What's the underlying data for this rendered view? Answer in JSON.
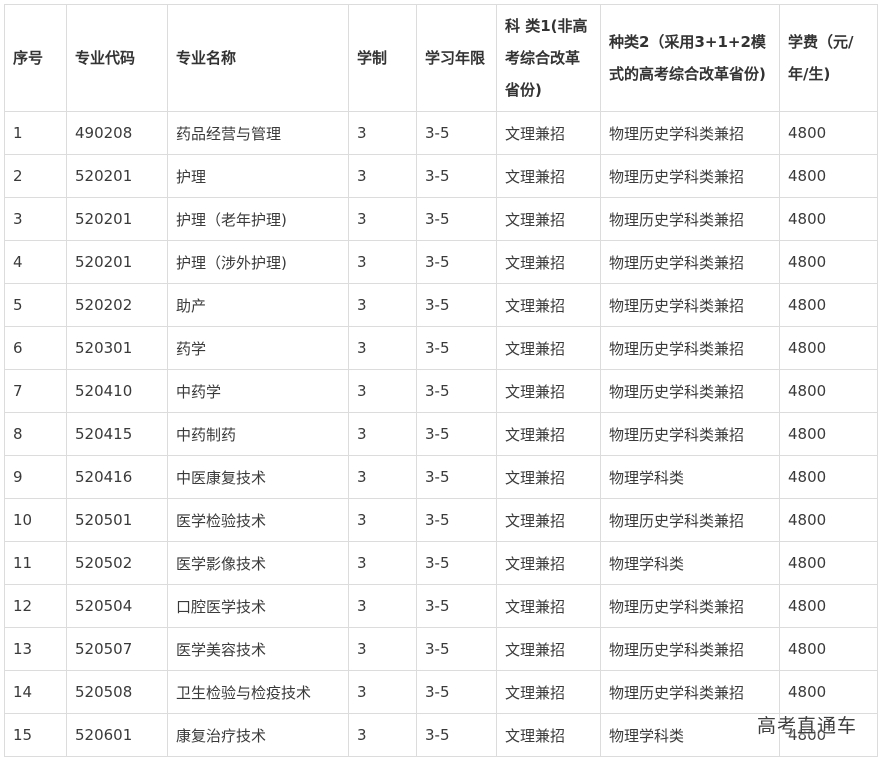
{
  "table": {
    "headers": {
      "index": "序号",
      "code": "专业代码",
      "name": "专业名称",
      "duration": "学制",
      "years": "学习年限",
      "category1": "科 类1(非高考综合改革省份)",
      "category2": "种类2（采用3+1+2模式的高考综合改革省份)",
      "fee": "学费（元/年/生)"
    },
    "rows": [
      {
        "index": "1",
        "code": "490208",
        "name": "药品经营与管理",
        "duration": "3",
        "years": "3-5",
        "category1": "文理兼招",
        "category2": "物理历史学科类兼招",
        "fee": "4800"
      },
      {
        "index": "2",
        "code": "520201",
        "name": "护理",
        "duration": "3",
        "years": "3-5",
        "category1": "文理兼招",
        "category2": "物理历史学科类兼招",
        "fee": "4800"
      },
      {
        "index": "3",
        "code": "520201",
        "name": "护理（老年护理)",
        "duration": "3",
        "years": "3-5",
        "category1": "文理兼招",
        "category2": "物理历史学科类兼招",
        "fee": "4800"
      },
      {
        "index": "4",
        "code": "520201",
        "name": "护理（涉外护理)",
        "duration": "3",
        "years": "3-5",
        "category1": "文理兼招",
        "category2": "物理历史学科类兼招",
        "fee": "4800"
      },
      {
        "index": "5",
        "code": "520202",
        "name": "助产",
        "duration": "3",
        "years": "3-5",
        "category1": "文理兼招",
        "category2": "物理历史学科类兼招",
        "fee": "4800"
      },
      {
        "index": "6",
        "code": "520301",
        "name": "药学",
        "duration": "3",
        "years": "3-5",
        "category1": "文理兼招",
        "category2": "物理历史学科类兼招",
        "fee": "4800"
      },
      {
        "index": "7",
        "code": "520410",
        "name": "中药学",
        "duration": "3",
        "years": "3-5",
        "category1": "文理兼招",
        "category2": "物理历史学科类兼招",
        "fee": "4800"
      },
      {
        "index": "8",
        "code": "520415",
        "name": "中药制药",
        "duration": "3",
        "years": "3-5",
        "category1": "文理兼招",
        "category2": "物理历史学科类兼招",
        "fee": "4800"
      },
      {
        "index": "9",
        "code": "520416",
        "name": "中医康复技术",
        "duration": "3",
        "years": "3-5",
        "category1": "文理兼招",
        "category2": "物理学科类",
        "fee": "4800"
      },
      {
        "index": "10",
        "code": "520501",
        "name": "医学检验技术",
        "duration": "3",
        "years": "3-5",
        "category1": "文理兼招",
        "category2": "物理历史学科类兼招",
        "fee": "4800"
      },
      {
        "index": "11",
        "code": "520502",
        "name": "医学影像技术",
        "duration": "3",
        "years": "3-5",
        "category1": "文理兼招",
        "category2": "物理学科类",
        "fee": "4800"
      },
      {
        "index": "12",
        "code": "520504",
        "name": "口腔医学技术",
        "duration": "3",
        "years": "3-5",
        "category1": "文理兼招",
        "category2": "物理历史学科类兼招",
        "fee": "4800"
      },
      {
        "index": "13",
        "code": "520507",
        "name": "医学美容技术",
        "duration": "3",
        "years": "3-5",
        "category1": "文理兼招",
        "category2": "物理历史学科类兼招",
        "fee": "4800"
      },
      {
        "index": "14",
        "code": "520508",
        "name": "卫生检验与检疫技术",
        "duration": "3",
        "years": "3-5",
        "category1": "文理兼招",
        "category2": "物理历史学科类兼招",
        "fee": "4800"
      },
      {
        "index": "15",
        "code": "520601",
        "name": "康复治疗技术",
        "duration": "3",
        "years": "3-5",
        "category1": "文理兼招",
        "category2": "物理学科类",
        "fee": "4800"
      }
    ]
  },
  "watermark": "高考直通车"
}
